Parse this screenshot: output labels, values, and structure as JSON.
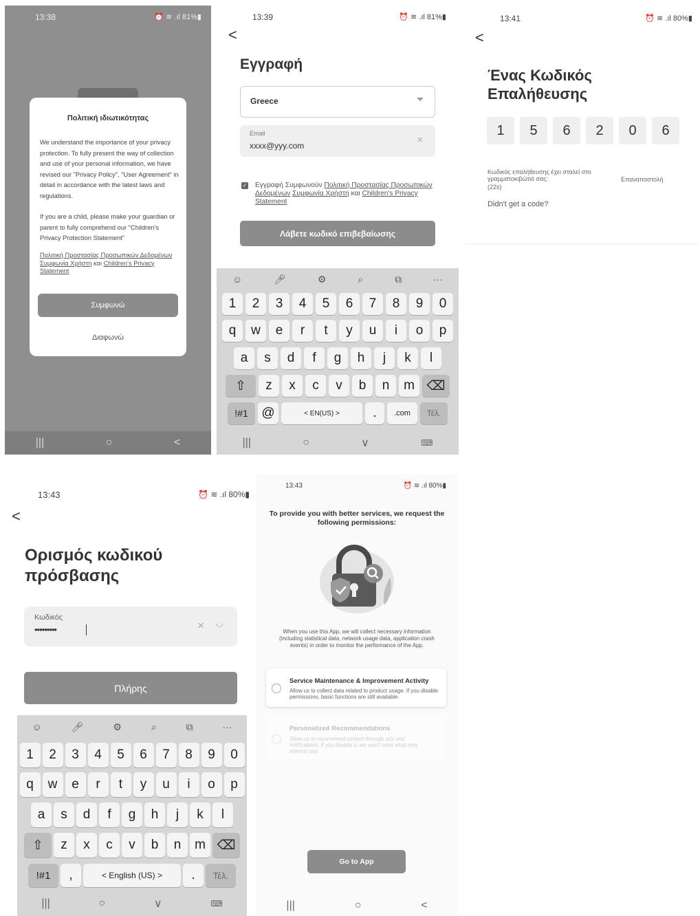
{
  "p1": {
    "time": "13:38",
    "status": "⏰ ≋ .ıl 81%▮",
    "title": "Πολιτική ιδιωτικότητας",
    "body": "We understand the importance of your privacy protection. To fully present the way of collection and use of your personal information, we have revised our \"Privacy Policy\", \"User Agreement\" in detail in accordance with the latest laws and regulations.",
    "body2": "If you are a child, please make your guardian or parent to fully comprehend our \"Children's Privacy Protection Statement\"",
    "link1": "Πολιτική Προστασίας Προσωπικών Δεδομένων",
    "link2": "Συμφωνία Χρήστη",
    "and": "και",
    "link3": "Children's Privacy Statement",
    "agree": "Συμφωνώ",
    "disagree": "Διαφωνώ"
  },
  "p2": {
    "time": "13:39",
    "status": "⏰ ≋ .ıl 81%▮",
    "back": "<",
    "title": "Εγγραφή",
    "country": "Greece",
    "email_label": "Email",
    "email_value": "xxxx@yyy.com",
    "clear": "×",
    "consent_prefix": "Εγγραφή Συμφωνούν",
    "consent_link1": "Πολιτική Προστασίας Προσωπικών Δεδομένων",
    "consent_link2": "Συμφωνία Χρήστη",
    "consent_and": "και",
    "consent_link3": "Children's Privacy Statement",
    "button": "Λάβετε κωδικό επιβεβαίωσης",
    "kb_row1": [
      "1",
      "2",
      "3",
      "4",
      "5",
      "6",
      "7",
      "8",
      "9",
      "0"
    ],
    "kb_row2": [
      "q",
      "w",
      "e",
      "r",
      "t",
      "y",
      "u",
      "i",
      "o",
      "p"
    ],
    "kb_row3": [
      "a",
      "s",
      "d",
      "f",
      "g",
      "h",
      "j",
      "k",
      "l"
    ],
    "kb_row4": [
      "z",
      "x",
      "c",
      "v",
      "b",
      "n",
      "m"
    ],
    "kb_sym": "!#1",
    "kb_at": "@",
    "kb_lang": "<  EN(US)  >",
    "kb_dot": ".",
    "kb_com": ".com",
    "kb_done": "Τέλ."
  },
  "p3": {
    "time": "13:41",
    "status": "⏰ ≋ .ıl 80%▮",
    "back": "<",
    "title": "Ένας Κωδικός Επαλήθευσης",
    "digits": [
      "1",
      "5",
      "6",
      "2",
      "0",
      "6"
    ],
    "info": "Κωδικός επαλήθευσης έχει σταλεί στο γραμματοκιβώτιό σας:",
    "resend": "Επαναποστολή",
    "timer": "(22s)",
    "no_code": "Didn't get a code?"
  },
  "p4": {
    "time": "13:43",
    "status": "⏰ ≋ .ıl 80%▮",
    "back": "<",
    "title": "Ορισμός κωδικού πρόσβασης",
    "field_label": "Κωδικός",
    "field_value": "•••••••••",
    "clear": "×",
    "eye": "◡",
    "button": "Πλήρης",
    "kb_row1": [
      "1",
      "2",
      "3",
      "4",
      "5",
      "6",
      "7",
      "8",
      "9",
      "0"
    ],
    "kb_row2": [
      "q",
      "w",
      "e",
      "r",
      "t",
      "y",
      "u",
      "i",
      "o",
      "p"
    ],
    "kb_row3": [
      "a",
      "s",
      "d",
      "f",
      "g",
      "h",
      "j",
      "k",
      "l"
    ],
    "kb_row4": [
      "z",
      "x",
      "c",
      "v",
      "b",
      "n",
      "m"
    ],
    "kb_sym": "!#1",
    "kb_comma": ",",
    "kb_lang": "<    English (US)    >",
    "kb_dot": ".",
    "kb_done": "Τέλ."
  },
  "p5": {
    "time": "13:43",
    "status": "⏰ ≋ .ıl 80%▮",
    "heading": "To provide you with better services, we request the following permissions:",
    "desc": "When you use this App, we will collect necessary information (including statistical data, network usage data, application crash events) in order to monitor the performance of the App.",
    "opt1_title": "Service Maintenance & Improvement Activity",
    "opt1_desc": "Allow us to collect data related to product usage. If you disable permissions, basic functions are still available.",
    "opt2_title": "Personalized Recommendations",
    "opt2_desc": "Allow us to recommend content through ads and notifications. If you disable it, we won't send what may interest you.",
    "button": "Go to App"
  },
  "nav": {
    "recent": "|||",
    "home": "○",
    "back": "<",
    "down": "∨",
    "kbd": "⌨"
  },
  "colors": {
    "dim": "#8f8f8f",
    "button": "#8c8c8c",
    "keyboard": "#d6d6d6"
  }
}
